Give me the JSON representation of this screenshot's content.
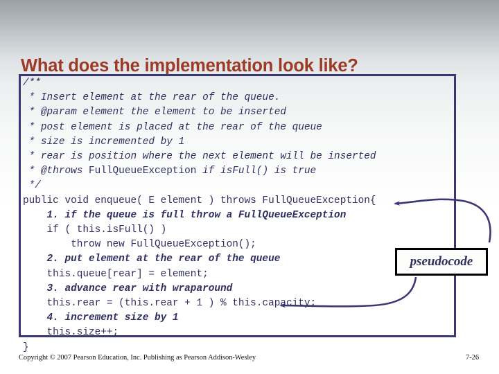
{
  "slide": {
    "title": "What does the implementation look like?",
    "title_color": "#9c3a26",
    "border_color": "#393875",
    "code_color": "#2f2f60"
  },
  "code": {
    "lines": [
      {
        "text": "/**",
        "style": "comment"
      },
      {
        "text": " * Insert element at the rear of the queue.",
        "style": "comment"
      },
      {
        "text": " * @param element the element to be inserted",
        "style": "comment"
      },
      {
        "text": " * post element is placed at the rear of the queue",
        "style": "comment"
      },
      {
        "text": " * size is incremented by 1",
        "style": "comment"
      },
      {
        "text": " * rear is position where the next element will be inserted",
        "style": "comment"
      },
      {
        "text": " * @throws FullQueueException if isFull() is true",
        "style": "comment"
      },
      {
        "text": " */",
        "style": "comment"
      },
      {
        "text": "public void enqueue( E element ) throws FullQueueException{",
        "style": "code"
      },
      {
        "text": "    1. if the queue is full throw a FullQueueException",
        "style": "pseudo"
      },
      {
        "text": "    if ( this.isFull() )",
        "style": "code"
      },
      {
        "text": "        throw new FullQueueException();",
        "style": "code"
      },
      {
        "text": "    2. put element at the rear of the queue",
        "style": "pseudo"
      },
      {
        "text": "    this.queue[rear] = element;",
        "style": "code"
      },
      {
        "text": "    3. advance rear with wraparound",
        "style": "pseudo"
      },
      {
        "text": "    this.rear = (this.rear + 1 ) % this.capacity;",
        "style": "code"
      },
      {
        "text": "    4. increment size by 1",
        "style": "pseudo"
      },
      {
        "text": "    this.size++;",
        "style": "code"
      },
      {
        "text": "}",
        "style": "code"
      }
    ]
  },
  "callout": {
    "label": "pseudocode"
  },
  "footer": {
    "copyright": "Copyright © 2007 Pearson Education, Inc. Publishing as Pearson Addison-Wesley",
    "page_number": "7-26"
  }
}
